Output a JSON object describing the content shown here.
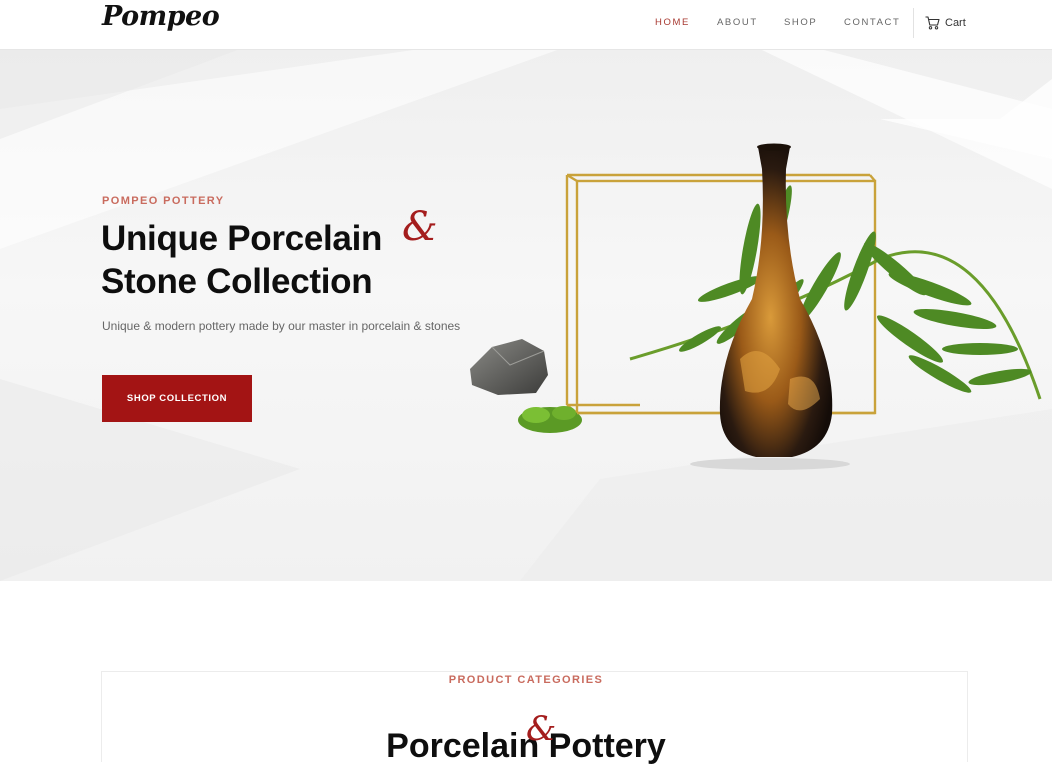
{
  "header": {
    "logo": "Pompeo",
    "nav": [
      {
        "label": "HOME",
        "active": true
      },
      {
        "label": "ABOUT",
        "active": false
      },
      {
        "label": "SHOP",
        "active": false
      },
      {
        "label": "CONTACT",
        "active": false
      }
    ],
    "cart_label": "Cart",
    "cart_icon": "cart-icon"
  },
  "hero": {
    "eyebrow": "POMPEO POTTERY",
    "title_line1": "Unique Porcelain",
    "title_line2": "Stone Collection",
    "ampersand": "&",
    "subtitle": "Unique & modern pottery made by our master in porcelain & stones",
    "button_label": "SHOP COLLECTION"
  },
  "categories": {
    "eyebrow": "PRODUCT CATEGORIES",
    "title": "Porcelain  Pottery",
    "ampersand": "&"
  },
  "colors": {
    "accent": "#a31414",
    "eyebrow": "#c96b5e",
    "nav_active": "#a83a32"
  }
}
